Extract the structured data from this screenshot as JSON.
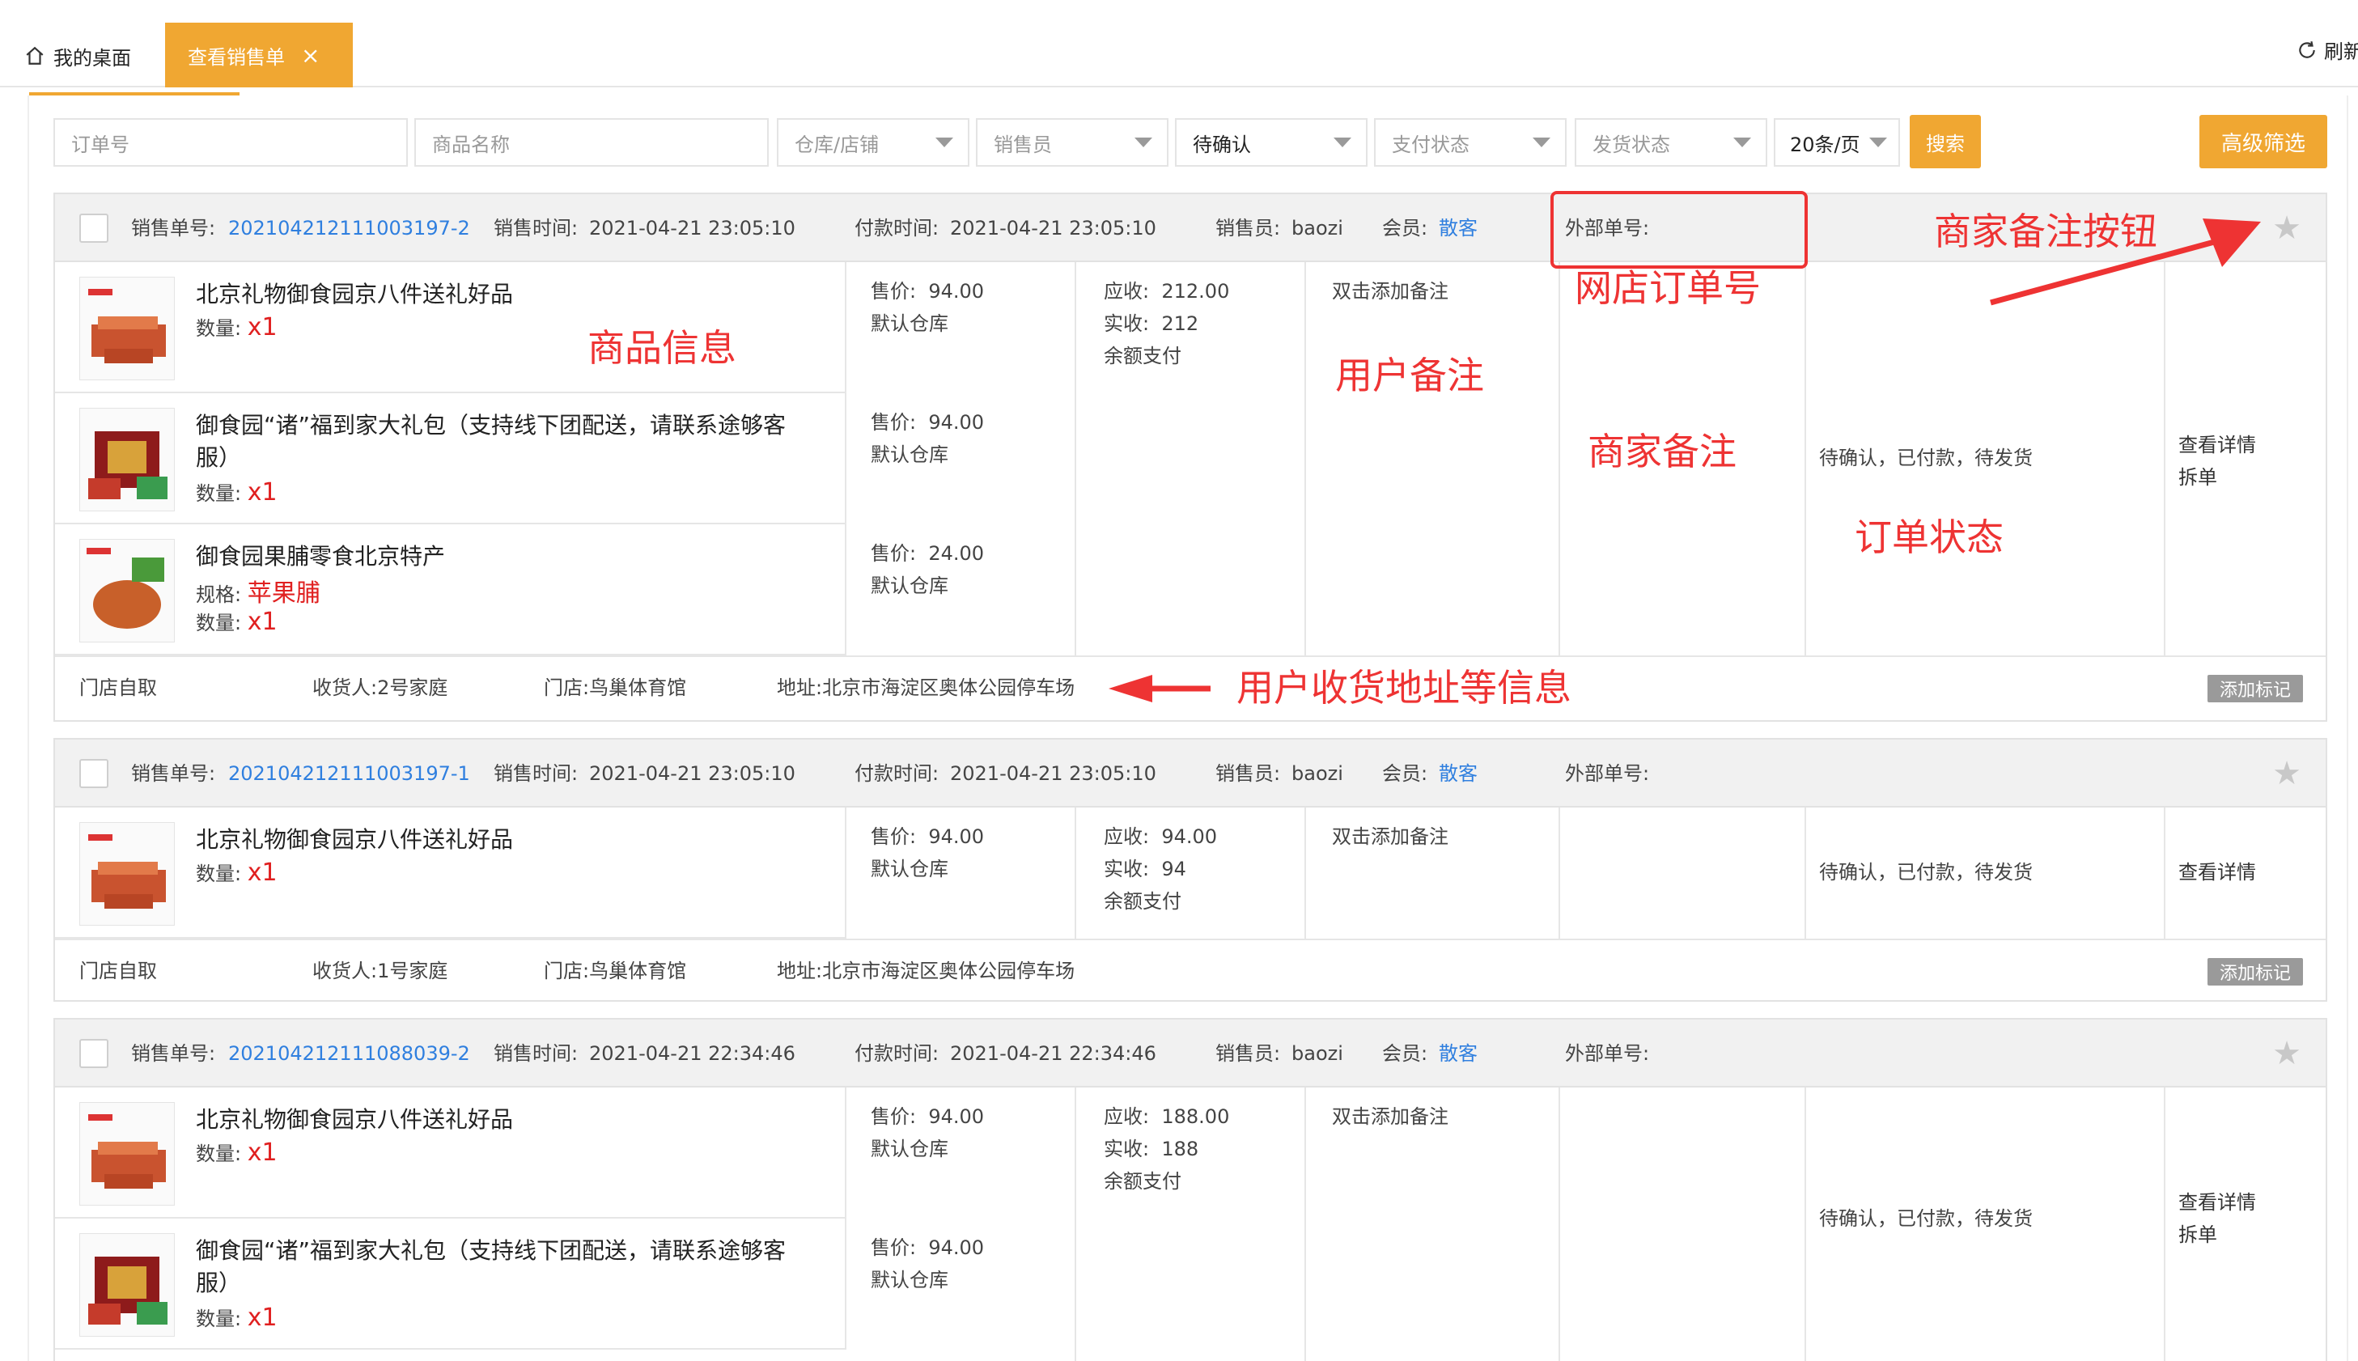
{
  "tabs": {
    "home": "我的桌面",
    "active": "查看销售单",
    "refresh": "刷新"
  },
  "filters": {
    "order_no": "订单号",
    "product_name": "商品名称",
    "warehouse": "仓库/店铺",
    "salesperson": "销售员",
    "confirm_status": "待确认",
    "pay_status": "支付状态",
    "ship_status": "发货状态",
    "page_size": "20条/页",
    "search": "搜索",
    "advanced": "高级筛选"
  },
  "labels": {
    "order_no": "销售单号:",
    "sale_time": "销售时间:",
    "pay_time": "付款时间:",
    "salesperson": "销售员:",
    "member": "会员:",
    "external_no": "外部单号:",
    "price": "售价:",
    "qty": "数量:",
    "spec": "规格:",
    "receivable": "应收:",
    "received": "实收:",
    "receiver": "收货人:",
    "store": "门店:",
    "address": "地址:",
    "add_remark": "双击添加备注",
    "add_tag": "添加标记",
    "view_detail": "查看详情",
    "split": "拆单"
  },
  "orders": [
    {
      "no": "202104212111003197-2",
      "sale_time": "2021-04-21 23:05:10",
      "pay_time": "2021-04-21 23:05:10",
      "salesperson": "baozi",
      "member": "散客",
      "items": [
        {
          "name": "北京礼物御食园京八件送礼好品",
          "qty": "x1",
          "price": "94.00",
          "warehouse": "默认仓库"
        },
        {
          "name": "御食园“诸”福到家大礼包（支持线下团配送，请联系途够客服）",
          "qty": "x1",
          "price": "94.00",
          "warehouse": "默认仓库"
        },
        {
          "name": "御食园果脯零食北京特产",
          "spec": "苹果脯",
          "qty": "x1",
          "price": "24.00",
          "warehouse": "默认仓库"
        }
      ],
      "receivable": "212.00",
      "received": "212",
      "pay_method": "余额支付",
      "status": "待确认，已付款，待发货",
      "delivery": "门店自取",
      "receiver": "2号家庭",
      "store": "鸟巢体育馆",
      "address": "北京市海淀区奥体公园停车场"
    },
    {
      "no": "202104212111003197-1",
      "sale_time": "2021-04-21 23:05:10",
      "pay_time": "2021-04-21 23:05:10",
      "salesperson": "baozi",
      "member": "散客",
      "items": [
        {
          "name": "北京礼物御食园京八件送礼好品",
          "qty": "x1",
          "price": "94.00",
          "warehouse": "默认仓库"
        }
      ],
      "receivable": "94.00",
      "received": "94",
      "pay_method": "余额支付",
      "status": "待确认，已付款，待发货",
      "delivery": "门店自取",
      "receiver": "1号家庭",
      "store": "鸟巢体育馆",
      "address": "北京市海淀区奥体公园停车场"
    },
    {
      "no": "202104212111088039-2",
      "sale_time": "2021-04-21 22:34:46",
      "pay_time": "2021-04-21 22:34:46",
      "salesperson": "baozi",
      "member": "散客",
      "items": [
        {
          "name": "北京礼物御食园京八件送礼好品",
          "qty": "x1",
          "price": "94.00",
          "warehouse": "默认仓库"
        },
        {
          "name": "御食园“诸”福到家大礼包（支持线下团配送，请联系途够客服）",
          "qty": "x1",
          "price": "94.00",
          "warehouse": "默认仓库"
        }
      ],
      "receivable": "188.00",
      "received": "188",
      "pay_method": "余额支付",
      "status": "待确认，已付款，待发货"
    }
  ],
  "annotations": {
    "product_info": "商品信息",
    "user_remark": "用户备注",
    "shop_order_no": "网店订单号",
    "merchant_remark": "商家备注",
    "order_status": "订单状态",
    "merchant_remark_button": "商家备注按钮",
    "address_info": "用户收货地址等信息"
  },
  "colors": {
    "accent": "#f0a732",
    "link": "#2f7fdf",
    "annotation": "#ee3333",
    "qty": "#e02020"
  }
}
